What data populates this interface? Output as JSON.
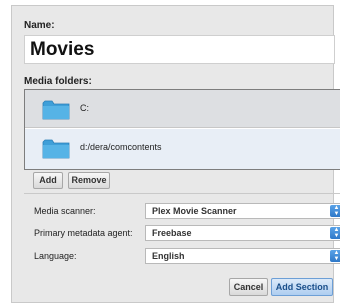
{
  "dialog": {
    "name_label": "Name:",
    "name_value": "Movies",
    "folders_label": "Media folders:",
    "folders": [
      {
        "path": "C:"
      },
      {
        "path": "d:/dera/comcontents"
      }
    ],
    "add_label": "Add",
    "remove_label": "Remove",
    "scanner_label": "Media scanner:",
    "scanner_value": "Plex Movie Scanner",
    "agent_label": "Primary metadata agent:",
    "agent_value": "Freebase",
    "language_label": "Language:",
    "language_value": "English",
    "cancel_label": "Cancel",
    "add_section_label": "Add Section"
  },
  "icons": {
    "folder": "folder-icon",
    "dropdown": "select-arrows-icon"
  },
  "colors": {
    "folder": "#3f9fd8",
    "accent": "#3a83d0",
    "selected_row": "#e8eef6"
  }
}
